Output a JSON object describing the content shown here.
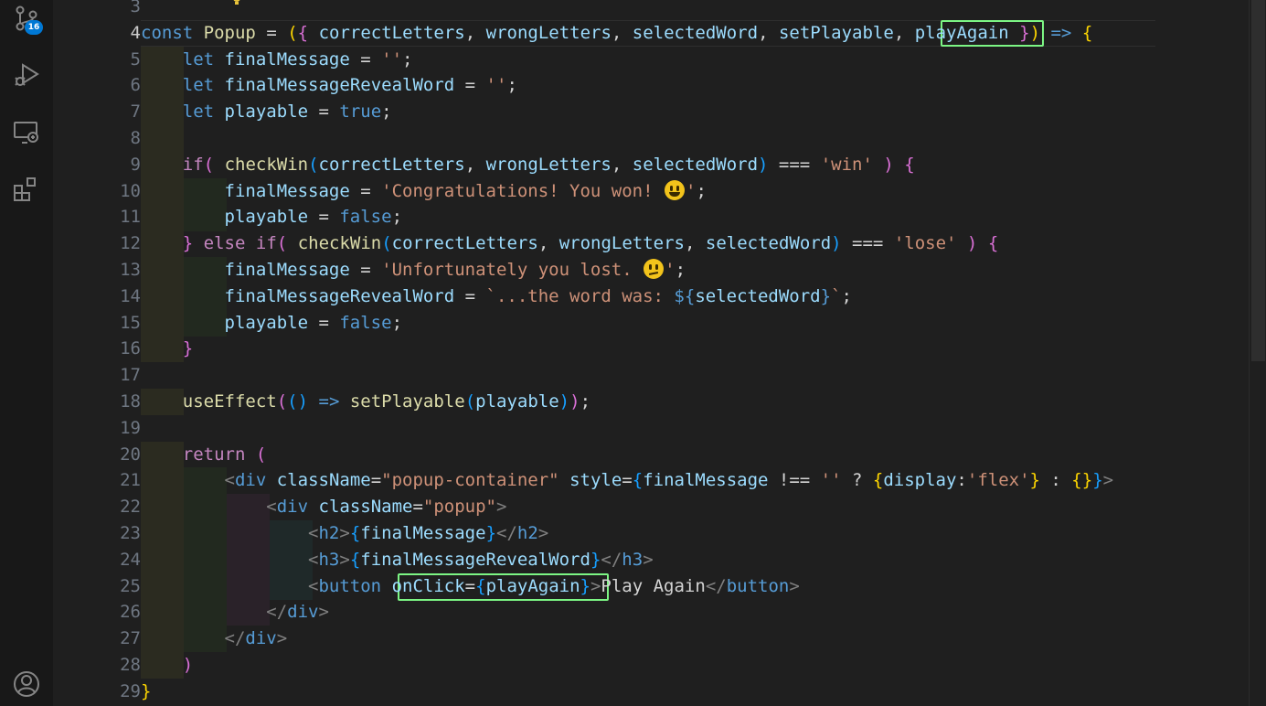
{
  "activity_bar": {
    "items": [
      {
        "name": "source-control-icon",
        "badge": "16"
      },
      {
        "name": "run-debug-icon"
      },
      {
        "name": "remote-explorer-icon"
      },
      {
        "name": "extensions-icon"
      },
      {
        "name": "accounts-icon"
      }
    ]
  },
  "editor": {
    "active_line": 4,
    "line_numbers": [
      "3",
      "4",
      "5",
      "6",
      "7",
      "8",
      "9",
      "10",
      "11",
      "12",
      "13",
      "14",
      "15",
      "16",
      "17",
      "18",
      "19",
      "20",
      "21",
      "22",
      "23",
      "24",
      "25",
      "26",
      "27",
      "28",
      "29"
    ],
    "highlighted_tokens": [
      "playAgain",
      "onClick={playAgain}"
    ]
  },
  "colors": {
    "keyword": "#569cd6",
    "control": "#c586c0",
    "variable": "#9cdcfe",
    "function": "#dcdcaa",
    "string": "#ce9178",
    "highlight_box": "#7cf584"
  }
}
